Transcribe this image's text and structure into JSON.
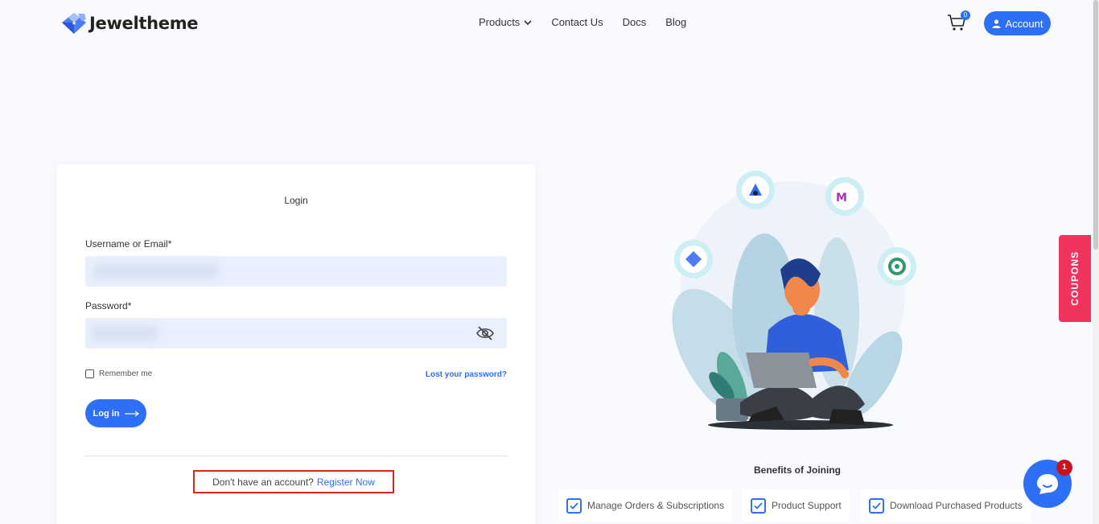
{
  "header": {
    "brand": "Jeweltheme",
    "nav": [
      {
        "label": "Products",
        "has_dropdown": true
      },
      {
        "label": "Contact Us"
      },
      {
        "label": "Docs"
      },
      {
        "label": "Blog"
      }
    ],
    "cart_count": "0",
    "account_label": "Account"
  },
  "login": {
    "title": "Login",
    "username_label": "Username or Email*",
    "password_label": "Password*",
    "remember_label": "Remember me",
    "lost_password": "Lost your password?",
    "login_button": "Log in",
    "register_prompt": "Don't have an account?",
    "register_link": "Register Now"
  },
  "benefits": {
    "title": "Benefits of Joining",
    "items": [
      "Manage Orders & Subscriptions",
      "Product Support",
      "Download Purchased Products"
    ]
  },
  "coupons_label": "COUPONS",
  "chat_badge": "1",
  "colors": {
    "accent": "#2d6ff7",
    "coupon": "#f2335e",
    "field_bg": "#e8effd"
  }
}
